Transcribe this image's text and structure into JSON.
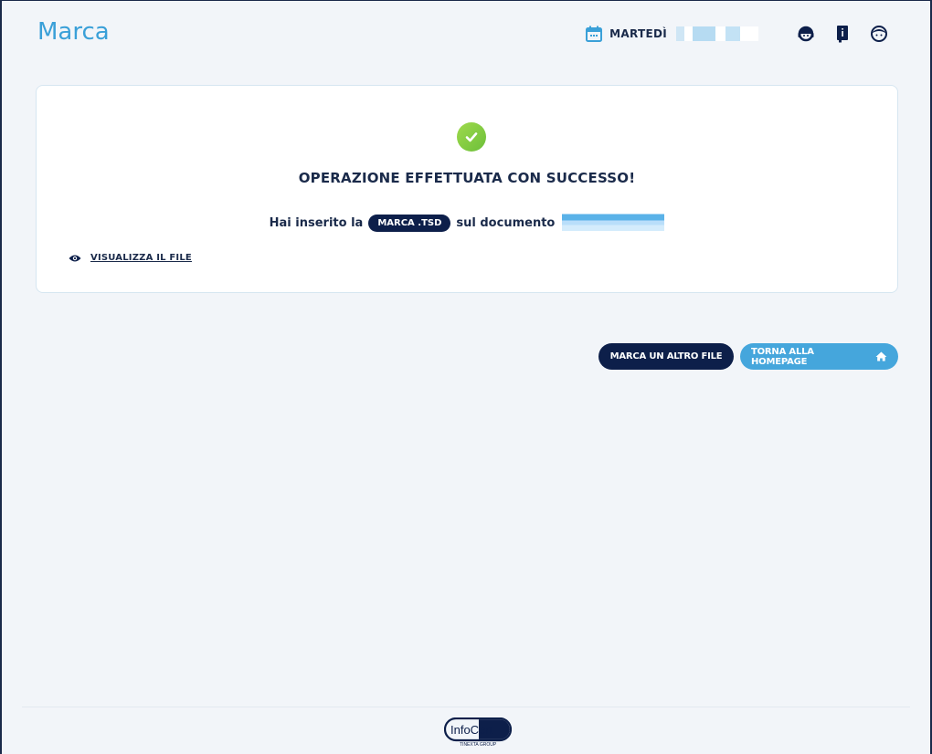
{
  "page": {
    "title": "Marca"
  },
  "header": {
    "day_label": "MARTEDÌ",
    "icons": [
      "calendar-icon",
      "support-icon",
      "manual-icon",
      "user-icon"
    ]
  },
  "result": {
    "title": "OPERAZIONE EFFETTUATA CON SUCCESSO!",
    "message_prefix": "Hai inserito la",
    "badge": "MARCA .TSD",
    "message_suffix": "sul documento",
    "view_link": "VISUALIZZA IL FILE"
  },
  "actions": {
    "mark_another": "MARCA UN ALTRO FILE",
    "back_home": "TORNA ALLA HOMEPAGE"
  },
  "footer": {
    "logo_text": "InfoCert",
    "logo_sub": "TINEXTA GROUP"
  },
  "colors": {
    "accent": "#3aa0d8",
    "navy": "#0d1f4a",
    "success": "#8bd042",
    "background": "#f2f5f9"
  }
}
